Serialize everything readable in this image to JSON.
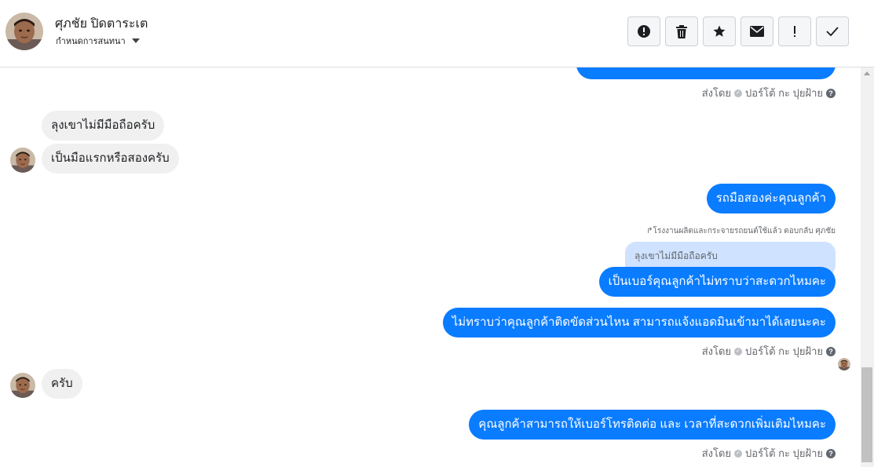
{
  "header": {
    "name": "ศุภชัย ปิดตาระเต",
    "subtitle": "กำหนดการสนทนา"
  },
  "toolbar": {
    "icons": [
      "alert-circle-icon",
      "trash-icon",
      "star-icon",
      "envelope-icon",
      "exclamation-icon",
      "check-icon"
    ]
  },
  "messages": {
    "m0_meta": "ส่งโดย",
    "m0_author": "ปอร์โต้ กะ ปุยฝ้าย",
    "in1": "ลุงเขาไม่มีมือถือครับ",
    "in2": "เป็นมือแรกหรือสองครับ",
    "out1": "รถมือสองค่ะคุณลูกค้า",
    "reply_note": "โรงงานผลิตและกระจายรถยนต์ใช้แล้ว ตอบกลับ ศุภชัย",
    "quote": "ลุงเขาไม่มีมือถือครับ",
    "out2": "เป็นเบอร์คุณลูกค้าไม่ทราบว่าสะดวกไหมคะ",
    "out3": "ไม่ทราบว่าคุณลูกค้าติดขัดส่วนไหน สามารถแจ้งแอดมินเข้ามาได้เลยนะคะ",
    "m1_meta": "ส่งโดย",
    "m1_author": "ปอร์โต้ กะ ปุยฝ้าย",
    "in3": "ครับ",
    "out4": "คุณลูกค้าสามารถให้เบอร์โทรติดต่อ และ เวลาที่สะดวกเพิ่มเติมไหมคะ",
    "m2_meta": "ส่งโดย",
    "m2_author": "ปอร์โต้ กะ ปุยฝ้าย"
  },
  "colors": {
    "outgoing_bubble": "#0a7cff",
    "incoming_bubble": "#f0f0f0",
    "quote_bubble": "#cfe2ff"
  }
}
